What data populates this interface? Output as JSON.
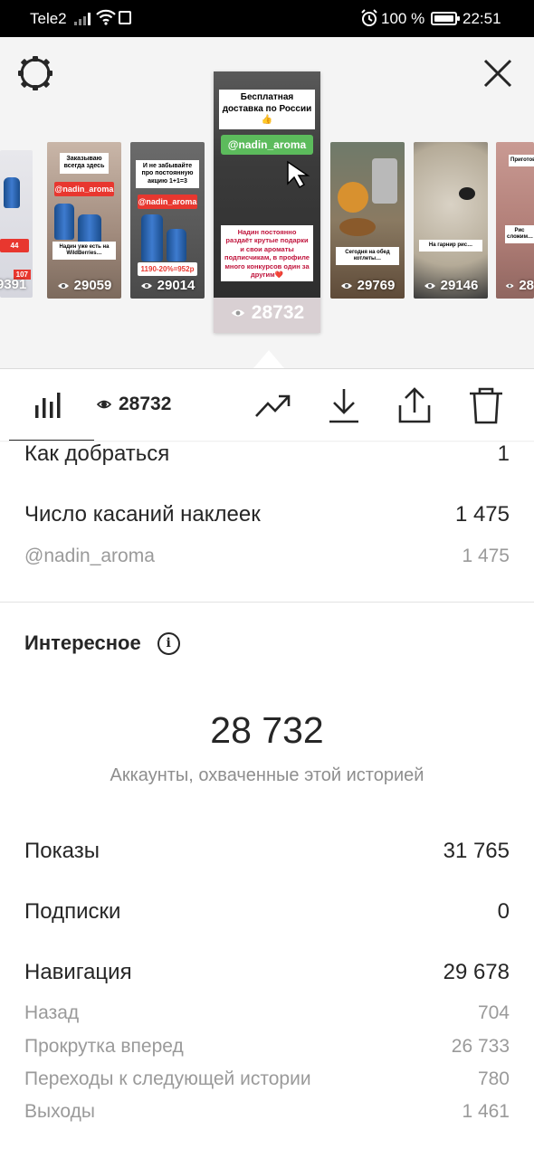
{
  "status_bar": {
    "carrier": "Tele2",
    "battery": "100 %",
    "time": "22:51",
    "icons": [
      "signal-icon",
      "wifi-icon",
      "notification-icon",
      "alarm-icon",
      "battery-icon"
    ]
  },
  "stories": {
    "thumbnails": [
      {
        "views": "9391"
      },
      {
        "views": "29059",
        "tag": "@nadin_aroma",
        "caption": "Заказываю всегда здесь"
      },
      {
        "views": "29014",
        "tag": "@nadin_aroma",
        "caption": "И не забывайте про постоянную акцию 1+1=3",
        "promo": "1190-20%=952р"
      },
      {
        "views": "28732",
        "headline": "Бесплатная доставка по России👍",
        "tag": "@nadin_aroma",
        "caption": "Надин постоянно раздаёт крутые подарки и свои ароматы подписчикам, в профиле много конкурсов один за другим❤️",
        "selected": true
      },
      {
        "views": "29769"
      },
      {
        "views": "29146"
      },
      {
        "views": "28"
      }
    ]
  },
  "toolbar": {
    "views": "28732",
    "icons": [
      "bar-chart-icon",
      "eye-icon",
      "trend-icon",
      "download-icon",
      "share-icon",
      "trash-icon"
    ]
  },
  "interactions": {
    "directions": {
      "label": "Как добраться",
      "value": "1"
    },
    "sticker_taps": {
      "label": "Число касаний наклеек",
      "value": "1 475"
    },
    "mention": {
      "label": "@nadin_aroma",
      "value": "1 475"
    }
  },
  "discovery": {
    "title": "Интересное",
    "reach": "28 732",
    "reach_label": "Аккаунты, охваченные этой историей",
    "impressions": {
      "label": "Показы",
      "value": "31 765"
    },
    "follows": {
      "label": "Подписки",
      "value": "0"
    },
    "navigation": {
      "label": "Навигация",
      "value": "29 678"
    },
    "back": {
      "label": "Назад",
      "value": "704"
    },
    "forward": {
      "label": "Прокрутка вперед",
      "value": "26 733"
    },
    "next_story": {
      "label": "Переходы к следующей истории",
      "value": "780"
    },
    "exited": {
      "label": "Выходы",
      "value": "1 461"
    }
  }
}
